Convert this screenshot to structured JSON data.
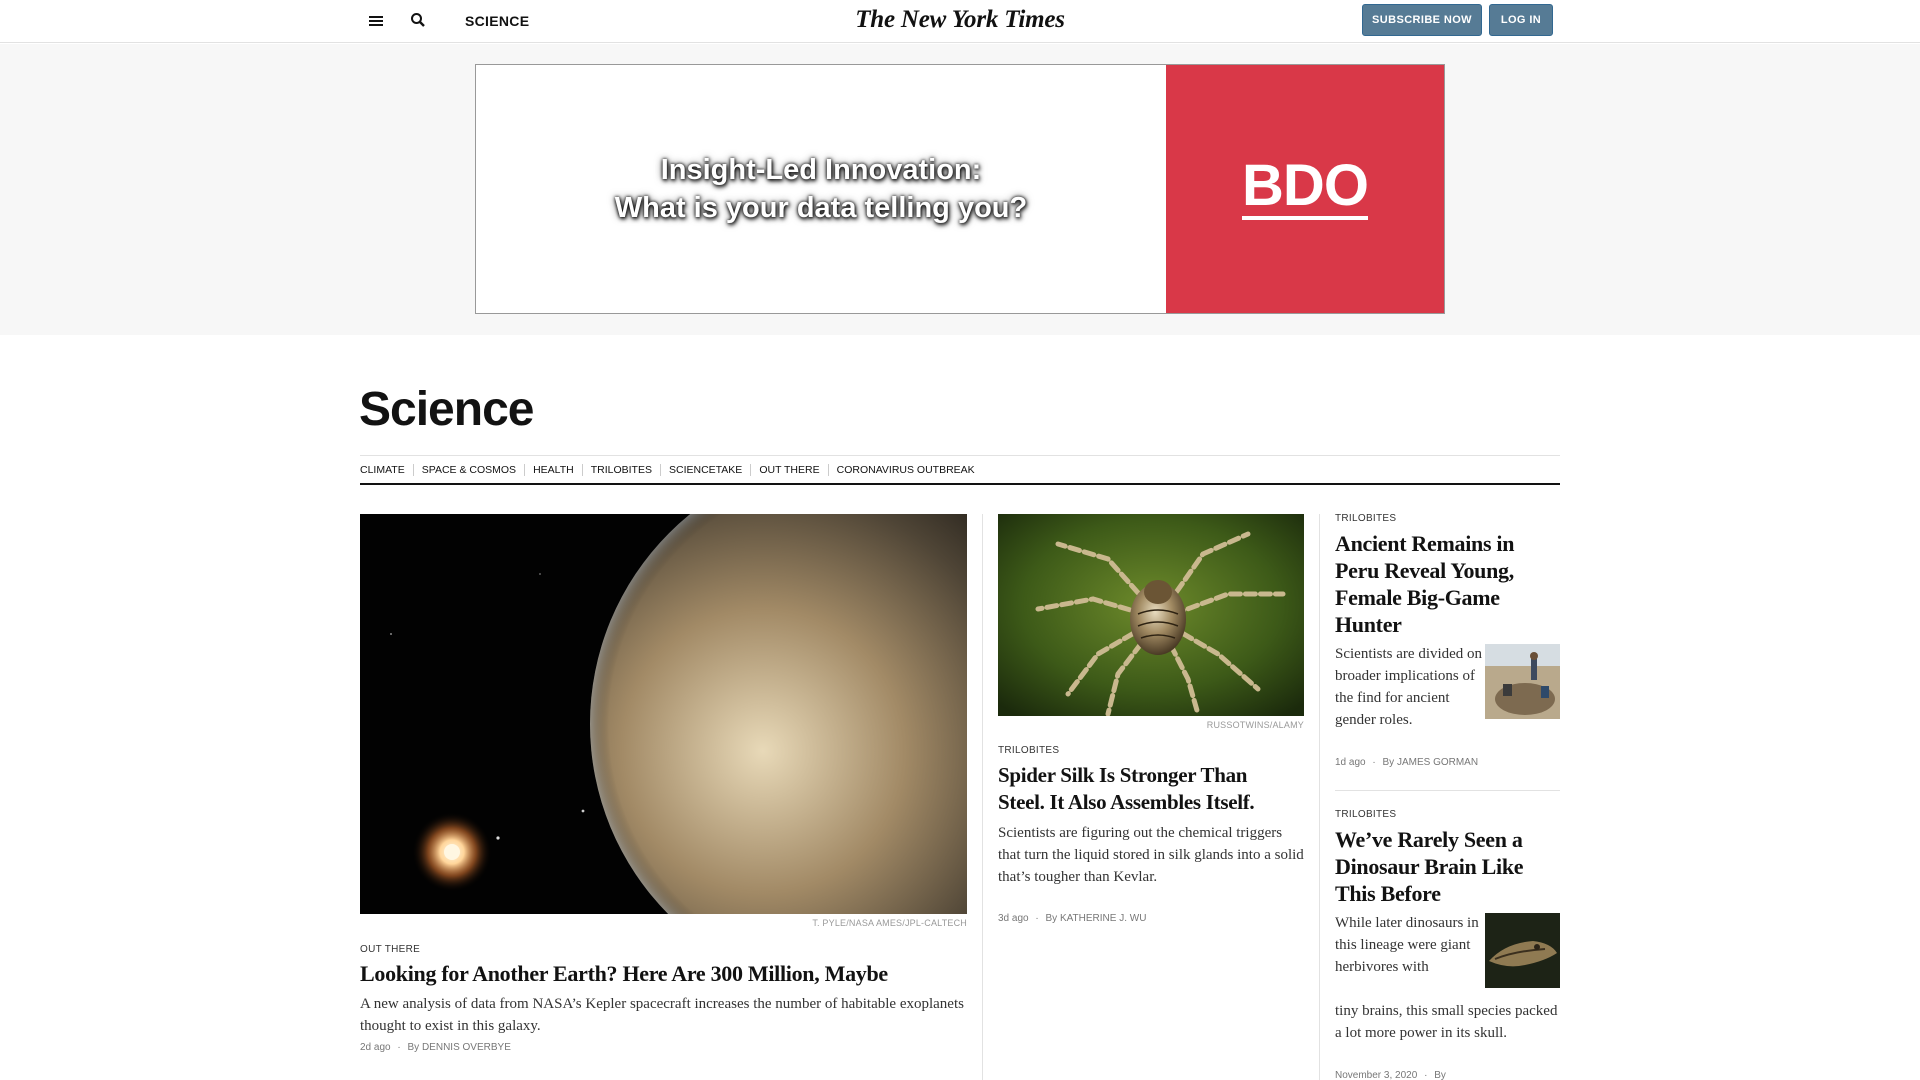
{
  "topbar": {
    "section": "SCIENCE",
    "masthead": "The New York Times",
    "subscribe_label": "SUBSCRIBE NOW",
    "login_label": "LOG IN"
  },
  "ad": {
    "line1": "Insight-Led Innovation:",
    "line2": "What is your data telling you?",
    "brand": "BDO",
    "brand_color": "#d93848"
  },
  "page": {
    "title": "Science",
    "subnav": [
      "CLIMATE",
      "SPACE & COSMOS",
      "HEALTH",
      "TRILOBITES",
      "SCIENCETAKE",
      "OUT THERE",
      "CORONAVIRUS OUTBREAK"
    ]
  },
  "lead": {
    "credit": "T. PYLE/NASA AMES/JPL-CALTECH",
    "kicker": "OUT THERE",
    "headline": "Looking for Another Earth? Here Are 300 Million, Maybe",
    "summary": "A new analysis of data from NASA’s Kepler spacecraft increases the number of habitable exoplanets thought to exist in this galaxy.",
    "time": "2d ago",
    "author": "DENNIS OVERBYE"
  },
  "second": {
    "credit": "RUSSOTWINS/ALAMY",
    "kicker": "TRILOBITES",
    "headline_line1": "Spider Silk Is Stronger Than",
    "headline_line2": "Steel. It Also Assembles Itself.",
    "summary": "Scientists are figuring out the chemical triggers that turn the liquid stored in silk glands into a solid that’s tougher than Kevlar.",
    "time": "3d ago",
    "author": "KATHERINE J. WU"
  },
  "third": {
    "kicker": "TRILOBITES",
    "headline": "Ancient Remains in Peru Reveal Young, Female Big-Game Hunter",
    "summary": "Scientists are divided on broader implications of the find for ancient gender roles.",
    "time": "1d ago",
    "author": "JAMES GORMAN"
  },
  "fourth": {
    "kicker": "TRILOBITES",
    "headline": "We’ve Rarely Seen a Dinosaur Brain Like This Before",
    "summary_a": "While later dinosaurs in this lineage were giant herbivores with",
    "summary_b": "tiny brains, this small species packed a lot more power in its skull.",
    "time": "November 3, 2020",
    "author_prefix": "By"
  },
  "byline_prefix": "By",
  "icons": {
    "menu": "hamburger-menu-icon",
    "search": "search-icon"
  }
}
